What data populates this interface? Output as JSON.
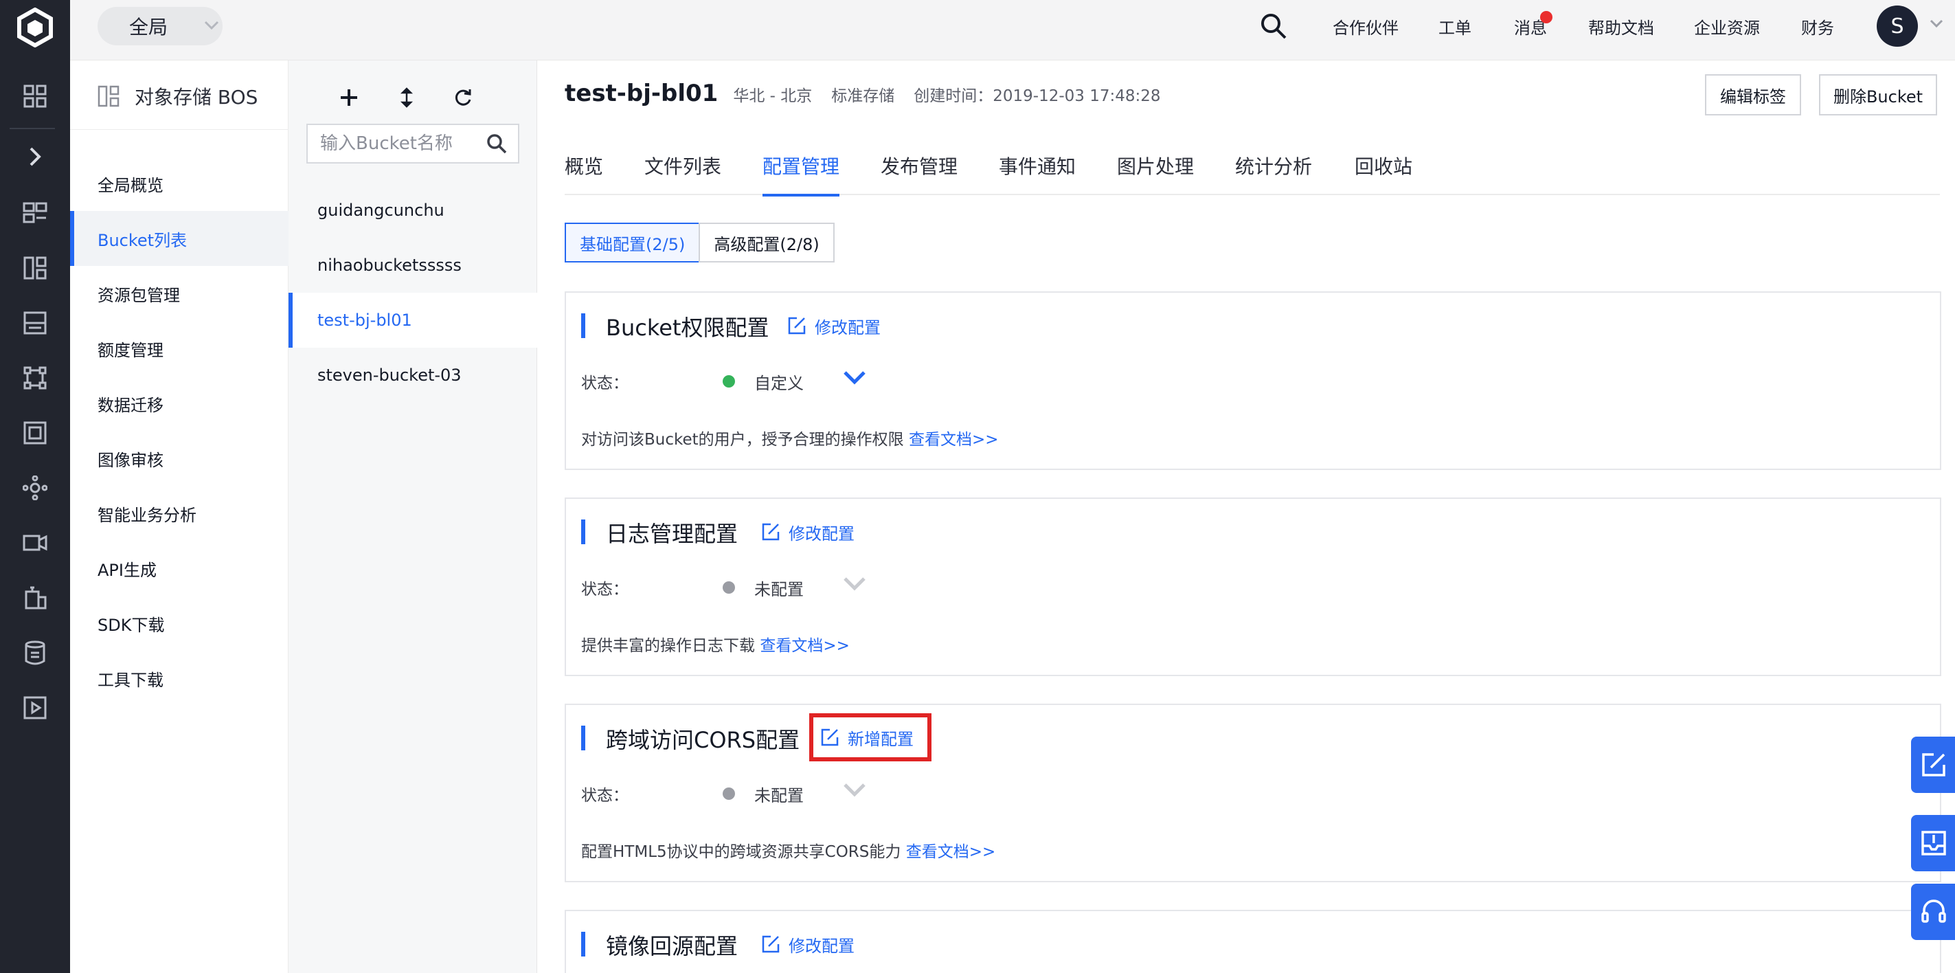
{
  "topbar": {
    "scope_label": "全局",
    "nav": [
      "合作伙伴",
      "工单",
      "消息",
      "帮助文档",
      "企业资源",
      "财务"
    ],
    "avatar_letter": "S"
  },
  "sidebar": {
    "title": "对象存储 BOS",
    "items": [
      {
        "label": "全局概览"
      },
      {
        "label": "Bucket列表",
        "active": true
      },
      {
        "label": "资源包管理"
      },
      {
        "label": "额度管理"
      },
      {
        "label": "数据迁移"
      },
      {
        "label": "图像审核"
      },
      {
        "label": "智能业务分析"
      },
      {
        "label": "API生成"
      },
      {
        "label": "SDK下载"
      },
      {
        "label": "工具下载"
      }
    ]
  },
  "bucket_list": {
    "search_placeholder": "输入Bucket名称",
    "items": [
      "guidangcunchu",
      "nihaobucketsssss",
      "test-bj-bl01",
      "steven-bucket-03"
    ],
    "active_index": 2
  },
  "header": {
    "bucket_name": "test-bj-bl01",
    "region": "华北 - 北京",
    "storage_class": "标准存储",
    "created": "创建时间：2019-12-03 17:48:28",
    "edit_tags_button": "编辑标签",
    "delete_button": "删除Bucket"
  },
  "tabs": [
    "概览",
    "文件列表",
    "配置管理",
    "发布管理",
    "事件通知",
    "图片处理",
    "统计分析",
    "回收站"
  ],
  "active_tab": "配置管理",
  "subtabs": [
    "基础配置(2/5)",
    "高级配置(2/8)"
  ],
  "cards": [
    {
      "title": "Bucket权限配置",
      "action": "修改配置",
      "status_label": "状态：",
      "status": "自定义",
      "status_color": "#34b35a",
      "description": "对访问该Bucket的用户，授予合理的操作权限",
      "doc_link": "查看文档>>"
    },
    {
      "title": "日志管理配置",
      "action": "修改配置",
      "status_label": "状态：",
      "status": "未配置",
      "status_color": "#9a9ca3",
      "description": "提供丰富的操作日志下载",
      "doc_link": "查看文档>>"
    },
    {
      "title": "跨域访问CORS配置",
      "action": "新增配置",
      "status_label": "状态：",
      "status": "未配置",
      "status_color": "#9a9ca3",
      "description": "配置HTML5协议中的跨域资源共享CORS能力",
      "doc_link": "查看文档>>",
      "highlighted": true
    },
    {
      "title": "镜像回源配置",
      "action": "修改配置"
    }
  ],
  "colors": {
    "accent": "#2468f2",
    "rail": "#22252e",
    "highlight_box": "#e02424"
  }
}
